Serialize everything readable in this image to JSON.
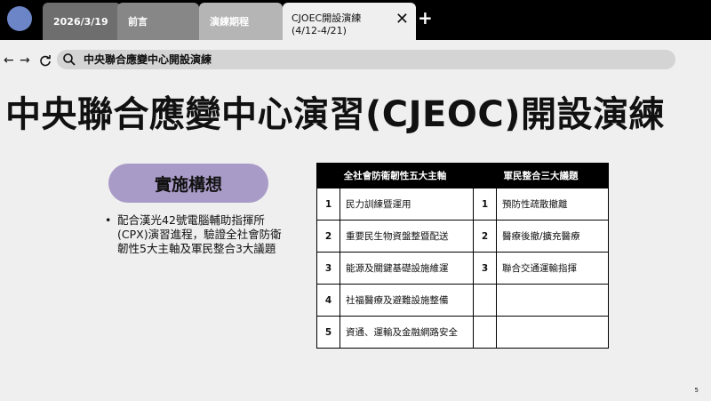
{
  "tabs": {
    "date": "2026/3/19",
    "preface": "前言",
    "schedule": "演練期程",
    "active_line1": "CJOEC開設演練",
    "active_line2": "(4/12-4/21)"
  },
  "address": {
    "text": "中央聯合應變中心開設演練"
  },
  "slide": {
    "title": "中央聯合應變中心演習(CJEOC)開設演練",
    "pill": "實施構想",
    "bullet": "配合漢光42號電腦輔助指揮所(CPX)演習進程，驗證全社會防衛韌性5大主軸及軍民整合3大議題",
    "table": {
      "header_left": "全社會防衛韌性五大主軸",
      "header_right": "軍民整合三大議題",
      "rows": [
        {
          "n1": "1",
          "a": "民力訓練暨運用",
          "n2": "1",
          "b": "預防性疏散撤離"
        },
        {
          "n1": "2",
          "a": "重要民生物資盤整暨配送",
          "n2": "2",
          "b": "醫療後撤/擴充醫療"
        },
        {
          "n1": "3",
          "a": "能源及關鍵基礎設施維運",
          "n2": "3",
          "b": "聯合交通運輸指揮"
        },
        {
          "n1": "4",
          "a": "社福醫療及避難設施整備",
          "n2": "",
          "b": ""
        },
        {
          "n1": "5",
          "a": "資通、運輸及金融網路安全",
          "n2": "",
          "b": ""
        }
      ]
    },
    "page_number": "5"
  },
  "colors": {
    "pill": "#a99bc7",
    "avatar": "#6b85c7",
    "tabbar": "#000000"
  }
}
